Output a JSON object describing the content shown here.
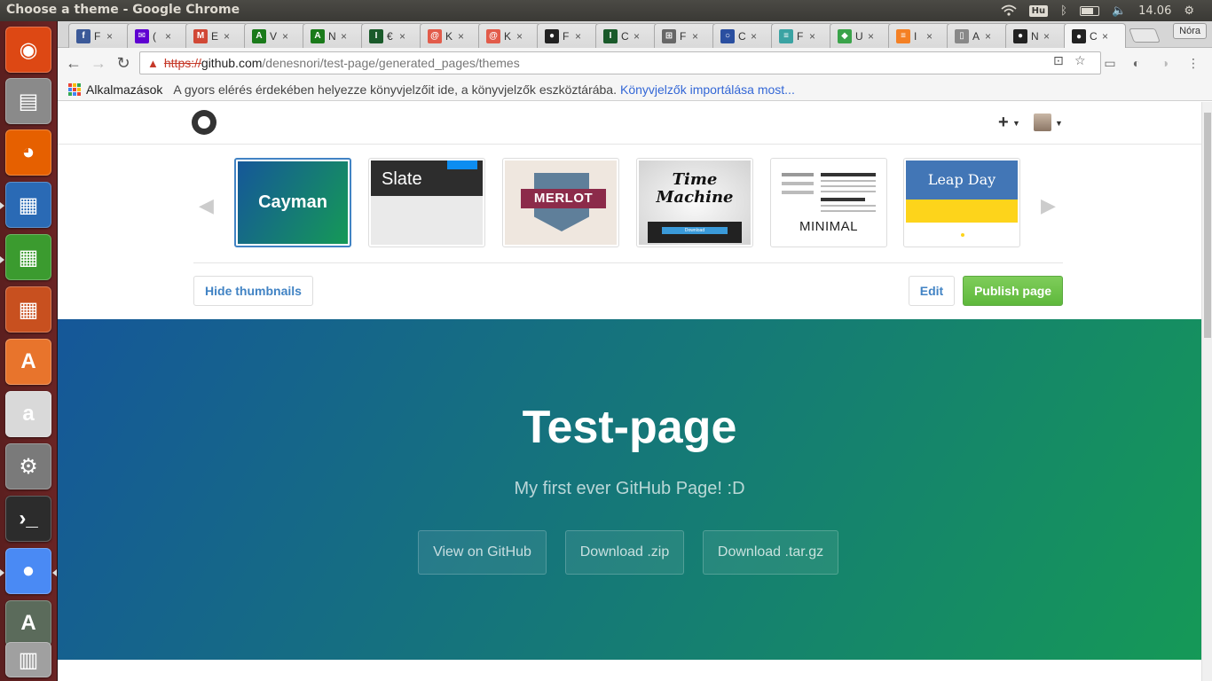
{
  "os": {
    "window_title": "Choose a theme - Google Chrome",
    "keyboard_layout": "Hu",
    "clock": "14.06",
    "launcher_items": [
      {
        "name": "ubuntu-dash-icon",
        "color": "#dd4814",
        "glyph": "◉"
      },
      {
        "name": "files-icon",
        "color": "#8a8a8a",
        "glyph": "▤"
      },
      {
        "name": "firefox-icon",
        "color": "#e66000",
        "glyph": "◕"
      },
      {
        "name": "writer-icon",
        "color": "#2a6ab5",
        "glyph": "▦"
      },
      {
        "name": "calc-icon",
        "color": "#3b9b2f",
        "glyph": "▦"
      },
      {
        "name": "impress-icon",
        "color": "#c8501f",
        "glyph": "▦"
      },
      {
        "name": "software-center-icon",
        "color": "#e8742c",
        "glyph": "A"
      },
      {
        "name": "amazon-icon",
        "color": "#d9d9d9",
        "glyph": "a"
      },
      {
        "name": "system-settings-icon",
        "color": "#7a7a7a",
        "glyph": "⚙"
      },
      {
        "name": "terminal-icon",
        "color": "#2c2c2c",
        "glyph": "›_"
      },
      {
        "name": "chrome-icon",
        "color": "#4a8af4",
        "glyph": "●"
      },
      {
        "name": "software-updater-icon",
        "color": "#5b6b5b",
        "glyph": "A"
      },
      {
        "name": "workspace-switcher-icon",
        "color": "#a0a0a0",
        "glyph": "▥"
      }
    ]
  },
  "browser": {
    "tabs": [
      {
        "icon": "facebook-icon",
        "color": "#3b5998",
        "glyph": "f",
        "title": "F"
      },
      {
        "icon": "yahoo-mail-icon",
        "color": "#5f01d1",
        "glyph": "✉",
        "title": "("
      },
      {
        "icon": "gmail-icon",
        "color": "#d14836",
        "glyph": "M",
        "title": "E"
      },
      {
        "icon": "app-icon",
        "color": "#1a7a1a",
        "glyph": "A",
        "title": "V"
      },
      {
        "icon": "app-icon",
        "color": "#1a7a1a",
        "glyph": "A",
        "title": "N"
      },
      {
        "icon": "app-icon",
        "color": "#1a5a2a",
        "glyph": "I",
        "title": "€"
      },
      {
        "icon": "swirl-icon",
        "color": "#e25b4a",
        "glyph": "@",
        "title": "K"
      },
      {
        "icon": "swirl-icon",
        "color": "#e25b4a",
        "glyph": "@",
        "title": "K"
      },
      {
        "icon": "github-icon",
        "color": "#222222",
        "glyph": "●",
        "title": "F"
      },
      {
        "icon": "app-icon",
        "color": "#1a5a2a",
        "glyph": "I",
        "title": "C"
      },
      {
        "icon": "book-icon",
        "color": "#666666",
        "glyph": "⊞",
        "title": "F"
      },
      {
        "icon": "circle-icon",
        "color": "#2a4fa0",
        "glyph": "○",
        "title": "C"
      },
      {
        "icon": "editor-icon",
        "color": "#3aa3a3",
        "glyph": "≡",
        "title": "F"
      },
      {
        "icon": "gem-icon",
        "color": "#3aa34a",
        "glyph": "◆",
        "title": "U"
      },
      {
        "icon": "stackoverflow-icon",
        "color": "#f48024",
        "glyph": "≡",
        "title": "I"
      },
      {
        "icon": "document-icon",
        "color": "#888888",
        "glyph": "▯",
        "title": "A"
      },
      {
        "icon": "github-icon",
        "color": "#222222",
        "glyph": "●",
        "title": "N"
      },
      {
        "icon": "github-icon",
        "color": "#222222",
        "glyph": "●",
        "title": "C",
        "active": true
      }
    ],
    "profile_name": "Nóra",
    "url": {
      "scheme": "https://",
      "host": "github.com",
      "path": "/denesnori/test-page/generated_pages/themes"
    },
    "bookmarks": {
      "apps_label": "Alkalmazások",
      "hint": "A gyors elérés érdekében helyezze könyvjelzőit ide, a könyvjelzők eszköztárába.",
      "import_link": "Könyvjelzők importálása most..."
    }
  },
  "page": {
    "themes": [
      {
        "id": "cayman",
        "label": "Cayman",
        "selected": true
      },
      {
        "id": "slate",
        "label": "Slate"
      },
      {
        "id": "merlot",
        "label": "MERLOT"
      },
      {
        "id": "time-machine",
        "label": "Time Machine"
      },
      {
        "id": "minimal",
        "label": "MINIMAL"
      },
      {
        "id": "leap-day",
        "label": "Leap Day"
      }
    ],
    "time_machine_button": "Download",
    "hide_thumbnails": "Hide thumbnails",
    "edit": "Edit",
    "publish": "Publish page",
    "preview": {
      "title": "Test-page",
      "tagline": "My first ever GitHub Page! :D",
      "buttons": [
        "View on GitHub",
        "Download .zip",
        "Download .tar.gz"
      ]
    }
  }
}
